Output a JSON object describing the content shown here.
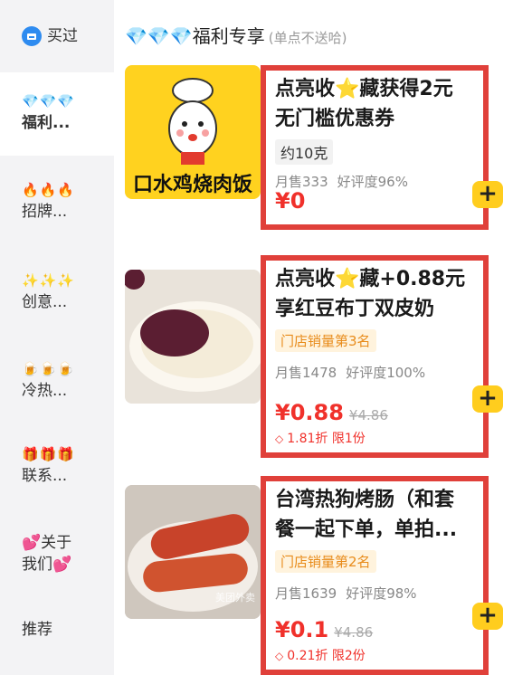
{
  "sidebar": {
    "items": [
      {
        "emoji": "",
        "label": "买过"
      },
      {
        "emoji": "💎💎💎",
        "label": "福利..."
      },
      {
        "emoji": "🔥🔥🔥",
        "label": "招牌..."
      },
      {
        "emoji": "✨✨✨",
        "label": "创意..."
      },
      {
        "emoji": "🍺🍺🍺",
        "label": "冷热..."
      },
      {
        "emoji": "🎁🎁🎁",
        "label": "联系..."
      },
      {
        "emoji": "",
        "label": "💕关于",
        "label2": "我们💕"
      },
      {
        "emoji": "",
        "label": "推荐"
      }
    ]
  },
  "section": {
    "title": "💎💎💎福利专享",
    "subtitle": "(单点不送哈)"
  },
  "products": [
    {
      "title1": "点亮收⭐藏获得2元",
      "title2": "无门槛优惠券",
      "tag": "约10克",
      "sales": "月售333",
      "rating": "好评度96%",
      "price": "¥0",
      "thumb_text": "口水鸡烧肉饭"
    },
    {
      "title1": "点亮收⭐藏+0.88元",
      "title2": "享红豆布丁双皮奶",
      "tag": "门店销量第3名",
      "sales": "月售1478",
      "rating": "好评度100%",
      "price": "¥0.88",
      "old_price": "¥4.86",
      "coupon": "1.81折 限1份"
    },
    {
      "title1": "台湾热狗烤肠（和套",
      "title2": "餐一起下单，单拍...",
      "tag": "门店销量第2名",
      "sales": "月售1639",
      "rating": "好评度98%",
      "price": "¥0.1",
      "old_price": "¥4.86",
      "coupon": "0.21折 限2份",
      "thumb_text": "美团外卖"
    }
  ],
  "add_label": "+"
}
